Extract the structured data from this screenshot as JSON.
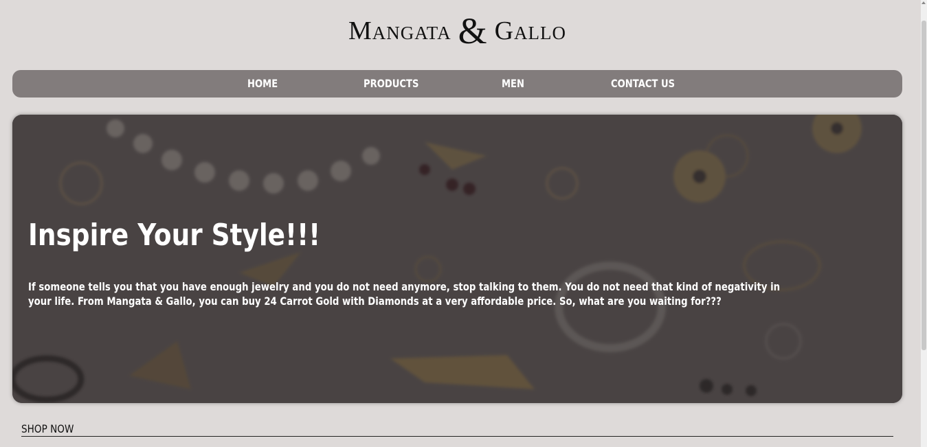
{
  "logo": {
    "word_left": "Mangata",
    "amp": "&",
    "word_right": "Gallo"
  },
  "nav": {
    "items": [
      {
        "label": "HOME"
      },
      {
        "label": "PRODUCTS"
      },
      {
        "label": "MEN"
      },
      {
        "label": "CONTACT US"
      }
    ]
  },
  "hero": {
    "title": "Inspire Your Style!!!",
    "text": "If someone tells you that you have enough jewelry and you do not need anymore, stop talking to them. You do not need that kind of negativity in your life. From Mangata & Gallo, you can buy 24 Carrot Gold with Diamonds at a very affordable price. So, what are you waiting for???"
  },
  "shop": {
    "label": "SHOP NOW"
  },
  "colors": {
    "background": "#dedad9",
    "nav": "#827c7c",
    "hero_overlay": "#4a4545"
  }
}
